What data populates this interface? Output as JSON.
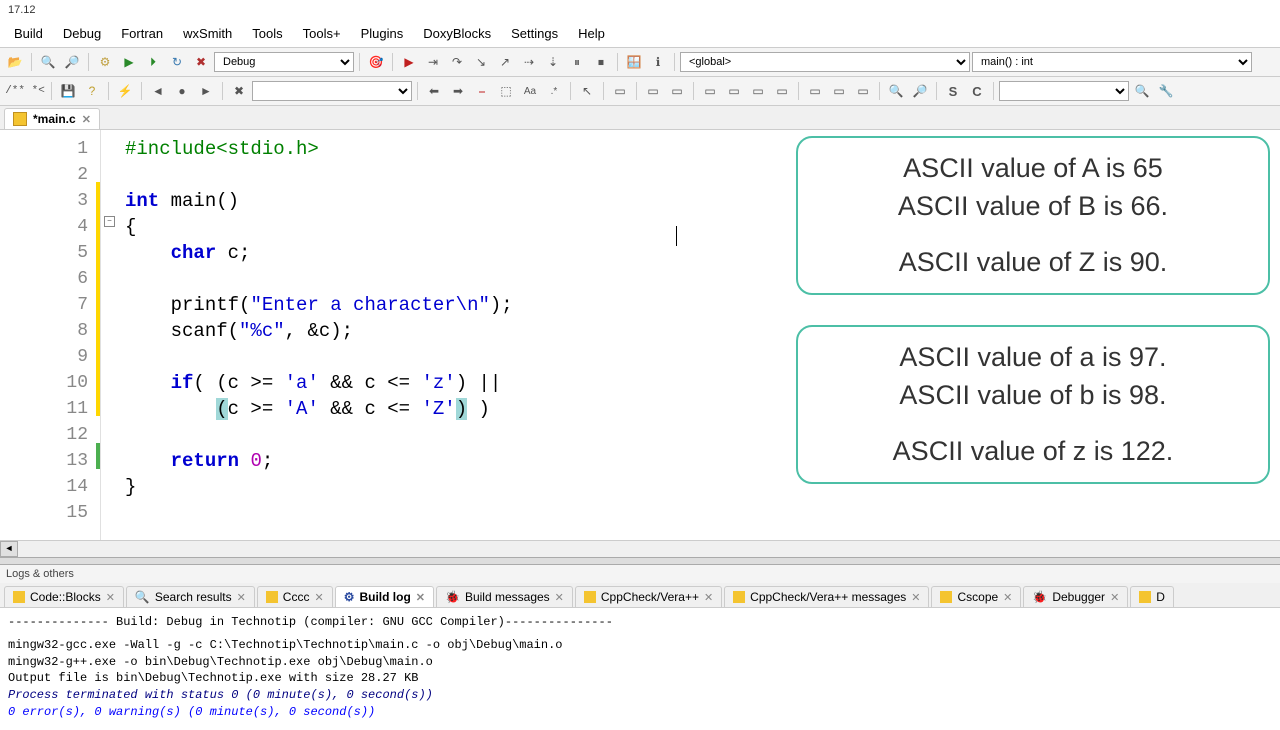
{
  "window": {
    "title": "17.12"
  },
  "menu": {
    "items": [
      "Build",
      "Debug",
      "Fortran",
      "wxSmith",
      "Tools",
      "Tools+",
      "Plugins",
      "DoxyBlocks",
      "Settings",
      "Help"
    ]
  },
  "toolbar1": {
    "config": "Debug",
    "scope": "<global>",
    "function": "main() : int"
  },
  "toolbar2": {
    "comment": "/** *<"
  },
  "open_file": {
    "name": "*main.c"
  },
  "gutter": {
    "lines": [
      1,
      2,
      3,
      4,
      5,
      6,
      7,
      8,
      9,
      10,
      11,
      12,
      13,
      14,
      15
    ]
  },
  "code": {
    "l1_a": "#include<stdio.h>",
    "l3_a": "int",
    "l3_b": " main()",
    "l4_a": "{",
    "l5_a": "char",
    "l5_b": " c;",
    "l7_a": "printf(",
    "l7_b": "\"Enter a character\\n\"",
    "l7_c": ");",
    "l8_a": "scanf(",
    "l8_b": "\"%c\"",
    "l8_c": ", &c);",
    "l10_a": "if",
    "l10_b": "( (c >= ",
    "l10_c": "'a'",
    "l10_d": " && c <= ",
    "l10_e": "'z'",
    "l10_f": ") ||",
    "l11_a": "(",
    "l11_b": "c >= ",
    "l11_c": "'A'",
    "l11_d": " && c <= ",
    "l11_e": "'Z'",
    "l11_f": ")",
    "l11_g": " )",
    "l13_a": "return",
    "l13_b": " ",
    "l13_c": "0",
    "l13_d": ";",
    "l14_a": "}"
  },
  "overlay1": {
    "line1": "ASCII value of A is 65",
    "line2": "ASCII value of B is 66.",
    "line3": "ASCII value of Z is 90."
  },
  "overlay2": {
    "line1": "ASCII value of a is 97.",
    "line2": "ASCII value of b is 98.",
    "line3": "ASCII value of z is 122."
  },
  "bottom": {
    "title": "Logs & others",
    "tabs": [
      "Code::Blocks",
      "Search results",
      "Cccc",
      "Build log",
      "Build messages",
      "CppCheck/Vera++",
      "CppCheck/Vera++ messages",
      "Cscope",
      "Debugger",
      "D"
    ],
    "active_tab": "Build log",
    "log": {
      "l1": "-------------- Build: Debug in Technotip (compiler: GNU GCC Compiler)---------------",
      "l2": "mingw32-gcc.exe -Wall -g  -c C:\\Technotip\\Technotip\\main.c -o obj\\Debug\\main.o",
      "l3": "mingw32-g++.exe  -o bin\\Debug\\Technotip.exe obj\\Debug\\main.o",
      "l4": "Output file is bin\\Debug\\Technotip.exe with size 28.27 KB",
      "l5": "Process terminated with status 0 (0 minute(s), 0 second(s))",
      "l6": "0 error(s), 0 warning(s) (0 minute(s), 0 second(s))"
    }
  }
}
